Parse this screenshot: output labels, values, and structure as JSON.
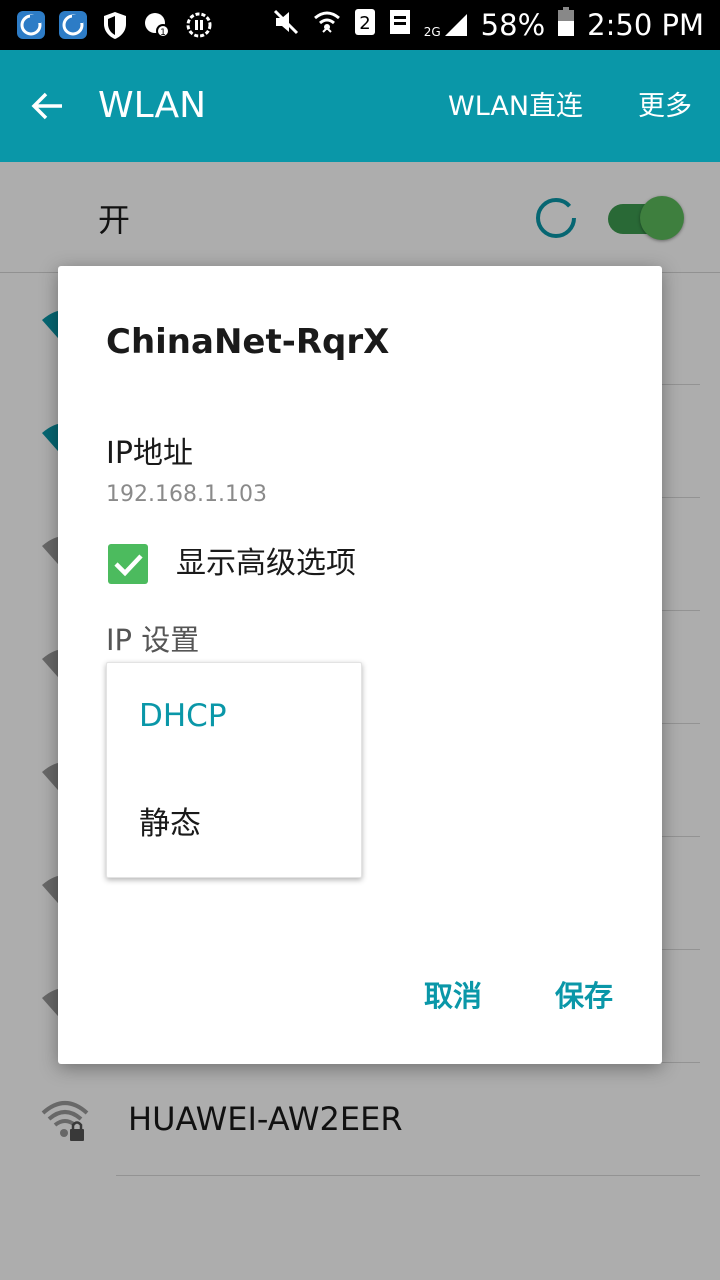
{
  "status_bar": {
    "icons": [
      "app-icon",
      "app-icon",
      "shield-icon",
      "sync-icon",
      "pause-icon",
      "muted-icon",
      "wifi-transfer-icon",
      "sim2-icon",
      "sms-icon",
      "signal-icon"
    ],
    "network_type": "2G",
    "battery_level": "58%",
    "time": "2:50 PM"
  },
  "app_bar": {
    "title": "WLAN",
    "wlan_direct": "WLAN直连",
    "more": "更多"
  },
  "wifi_toggle": {
    "label": "开",
    "enabled": true
  },
  "networks": [
    {
      "name": ""
    },
    {
      "name": ""
    },
    {
      "name": ""
    },
    {
      "name": ""
    },
    {
      "name": ""
    },
    {
      "name": ""
    },
    {
      "name": ""
    },
    {
      "name": "HUAWEI-AW2EER",
      "locked": true
    }
  ],
  "dialog": {
    "title": "ChinaNet-RqrX",
    "ip_label": "IP地址",
    "ip_value": "192.168.1.103",
    "show_advanced": {
      "checked": true,
      "label": "显示高级选项"
    },
    "ip_settings_label": "IP 设置",
    "ip_options": [
      "DHCP",
      "静态"
    ],
    "ip_selected": "DHCP",
    "cancel": "取消",
    "save": "保存"
  },
  "colors": {
    "accent": "#0a97a8",
    "check": "#4cbb5e",
    "toggle_on": "#5cbc5c"
  }
}
